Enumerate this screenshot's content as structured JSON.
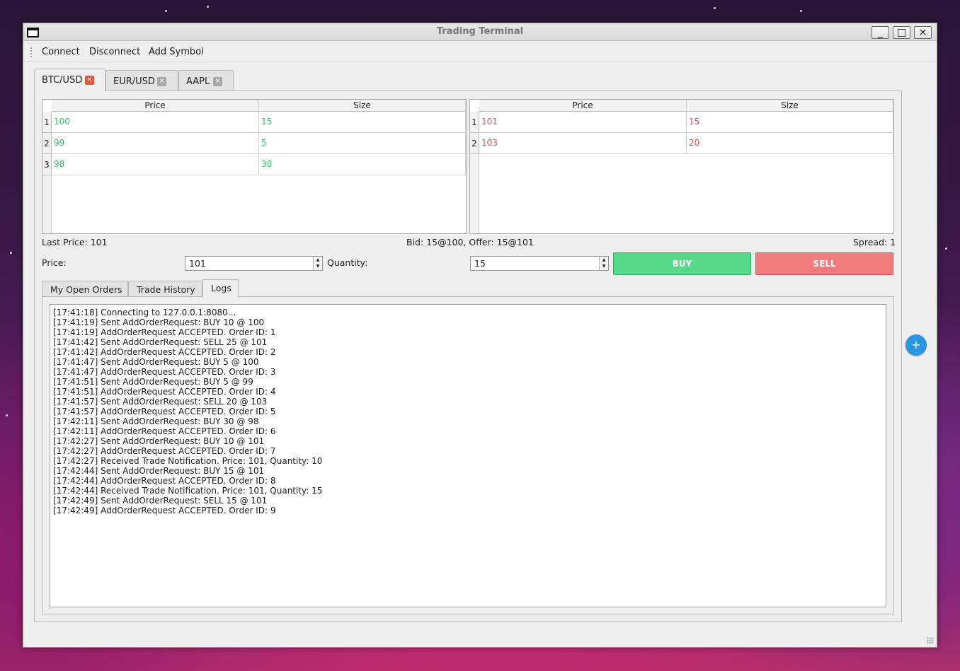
{
  "window": {
    "title": "Trading Terminal",
    "minimize_glyph": "_",
    "maximize_glyph": "□",
    "close_glyph": "×"
  },
  "menu": {
    "connect": "Connect",
    "disconnect": "Disconnect",
    "add_symbol": "Add Symbol"
  },
  "symbol_tabs": [
    {
      "label": "BTC/USD",
      "active": true
    },
    {
      "label": "EUR/USD",
      "active": false
    },
    {
      "label": "AAPL",
      "active": false
    }
  ],
  "tab_close_glyph": "×",
  "bids": {
    "headers": [
      "Price",
      "Size"
    ],
    "rows": [
      {
        "n": "1",
        "price": "100",
        "size": "15"
      },
      {
        "n": "2",
        "price": "99",
        "size": "5"
      },
      {
        "n": "3",
        "price": "98",
        "size": "30"
      }
    ]
  },
  "asks": {
    "headers": [
      "Price",
      "Size"
    ],
    "rows": [
      {
        "n": "1",
        "price": "101",
        "size": "15"
      },
      {
        "n": "2",
        "price": "103",
        "size": "20"
      }
    ]
  },
  "market": {
    "last_price": "Last Price: 101",
    "bid_offer": "Bid: 15@100, Offer: 15@101",
    "spread": "Spread: 1"
  },
  "order_form": {
    "price_label": "Price:",
    "price_value": "101",
    "quantity_label": "Quantity:",
    "quantity_value": "15",
    "buy_label": "BUY",
    "sell_label": "SELL"
  },
  "bottom_tabs": [
    {
      "label": "My Open Orders",
      "active": false
    },
    {
      "label": "Trade History",
      "active": false
    },
    {
      "label": "Logs",
      "active": true
    }
  ],
  "logs": [
    "[17:41:18] Connecting to 127.0.0.1:8080...",
    "[17:41:19] Sent AddOrderRequest: BUY 10 @ 100",
    "[17:41:19] AddOrderRequest ACCEPTED. Order ID: 1",
    "[17:41:42] Sent AddOrderRequest: SELL 25 @ 101",
    "[17:41:42] AddOrderRequest ACCEPTED. Order ID: 2",
    "[17:41:47] Sent AddOrderRequest: BUY 5 @ 100",
    "[17:41:47] AddOrderRequest ACCEPTED. Order ID: 3",
    "[17:41:51] Sent AddOrderRequest: BUY 5 @ 99",
    "[17:41:51] AddOrderRequest ACCEPTED. Order ID: 4",
    "[17:41:57] Sent AddOrderRequest: SELL 20 @ 103",
    "[17:41:57] AddOrderRequest ACCEPTED. Order ID: 5",
    "[17:42:11] Sent AddOrderRequest: BUY 30 @ 98",
    "[17:42:11] AddOrderRequest ACCEPTED. Order ID: 6",
    "[17:42:27] Sent AddOrderRequest: BUY 10 @ 101",
    "[17:42:27] AddOrderRequest ACCEPTED. Order ID: 7",
    "[17:42:27] Received Trade Notification. Price: 101, Quantity: 10",
    "[17:42:44] Sent AddOrderRequest: BUY 15 @ 101",
    "[17:42:44] AddOrderRequest ACCEPTED. Order ID: 8",
    "[17:42:44] Received Trade Notification. Price: 101, Quantity: 15",
    "[17:42:49] Sent AddOrderRequest: SELL 15 @ 101",
    "[17:42:49] AddOrderRequest ACCEPTED. Order ID: 9"
  ],
  "fab_label": "+",
  "colors": {
    "bid": "#2ec46a",
    "ask": "#e05252",
    "buy": "#57d98a",
    "sell": "#f07c7c",
    "accent": "#2b95e0"
  }
}
